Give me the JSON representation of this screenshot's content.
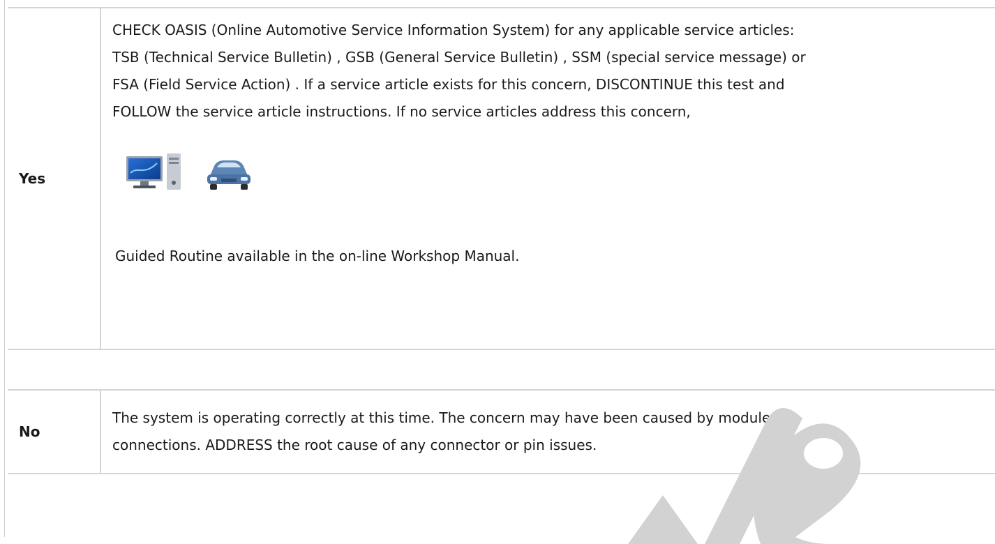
{
  "yes_row": {
    "label": "Yes",
    "paragraph_lines": [
      "CHECK OASIS (Online Automotive Service Information System)  for any applicable service articles:",
      "TSB (Technical Service Bulletin) , GSB (General Service Bulletin) , SSM (special service message)  or",
      "FSA (Field Service Action) . If a service article exists for this concern, DISCONTINUE this test and",
      "FOLLOW the service article instructions. If no service articles address this concern,"
    ],
    "icons": [
      "computer-icon",
      "vehicle-icon"
    ],
    "guided_text": " Guided Routine available in the on-line Workshop Manual."
  },
  "no_row": {
    "label": "No",
    "paragraph_lines": [
      "The system is operating correctly at this time. The concern may have been caused by module",
      "connections. ADDRESS the root cause of any connector or pin issues."
    ]
  },
  "colors": {
    "border": "#d4d4d4",
    "text": "#1a1a1a",
    "watermark": "#cfcfcf"
  }
}
